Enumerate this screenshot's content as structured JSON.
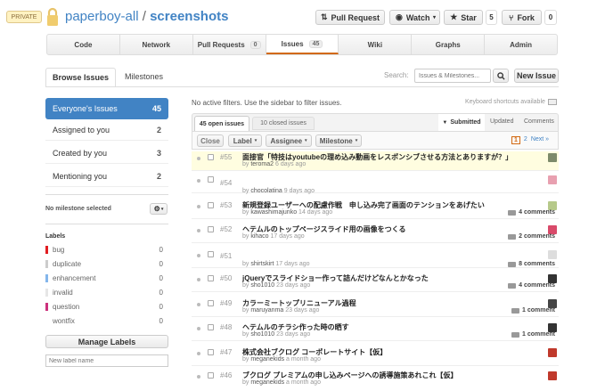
{
  "repo": {
    "badge": "PRIVATE",
    "owner": "paperboy-all",
    "sep": "/",
    "name": "screenshots"
  },
  "actions": {
    "pull_request": "Pull Request",
    "watch": "Watch",
    "star": "Star",
    "star_count": "5",
    "fork": "Fork",
    "fork_count": "0"
  },
  "nav": {
    "tabs": [
      {
        "label": "Code"
      },
      {
        "label": "Network"
      },
      {
        "label": "Pull Requests",
        "count": "0"
      },
      {
        "label": "Issues",
        "count": "45"
      },
      {
        "label": "Wiki"
      },
      {
        "label": "Graphs"
      },
      {
        "label": "Admin"
      }
    ]
  },
  "subtabs": {
    "browse": "Browse Issues",
    "milestones": "Milestones"
  },
  "search": {
    "label": "Search:",
    "placeholder": "Issues & Milestones...",
    "new_issue": "New Issue"
  },
  "filter_msg": "No active filters. Use the sidebar to filter issues.",
  "shortcuts": "Keyboard shortcuts available",
  "sidebar": {
    "items": [
      {
        "label": "Everyone's Issues",
        "count": "45"
      },
      {
        "label": "Assigned to you",
        "count": "2"
      },
      {
        "label": "Created by you",
        "count": "3"
      },
      {
        "label": "Mentioning you",
        "count": "2"
      }
    ],
    "milestone": "No milestone selected",
    "labels_heading": "Labels",
    "labels": [
      {
        "name": "bug",
        "count": "0",
        "color": "#e11d21"
      },
      {
        "name": "duplicate",
        "count": "0",
        "color": "#cccccc"
      },
      {
        "name": "enhancement",
        "count": "0",
        "color": "#84b6eb"
      },
      {
        "name": "invalid",
        "count": "0",
        "color": "#e6e6e6"
      },
      {
        "name": "question",
        "count": "0",
        "color": "#cc317c"
      },
      {
        "name": "wontfix",
        "count": "0",
        "color": "#ffffff"
      }
    ],
    "manage_labels": "Manage Labels",
    "new_label_placeholder": "New label name"
  },
  "list": {
    "open_tab": "45 open issues",
    "closed_tab": "10 closed issues",
    "sort": {
      "submitted": "Submitted",
      "updated": "Updated",
      "comments": "Comments"
    },
    "toolbar": {
      "close": "Close",
      "label": "Label",
      "assignee": "Assignee",
      "milestone": "Milestone"
    },
    "pagination": {
      "p1": "1",
      "p2": "2",
      "next": "Next »"
    }
  },
  "issues": [
    {
      "num": "#55",
      "title": "面接官「特技はyoutubeの理め込み動画をレスポンシブさせる方法とありますが？」",
      "user": "teroma2",
      "time": "6 days ago",
      "comments": "",
      "avatar": "#7d8a6a"
    },
    {
      "num": "#54",
      "title": "",
      "user": "chocolatina",
      "time": "9 days ago",
      "comments": "",
      "avatar": "#e8a0b0"
    },
    {
      "num": "#53",
      "title": "新規登録ユーザーへの配慮作戦　申し込み完了画面のテンションをあげたい",
      "user": "kawashimajunko",
      "time": "14 days ago",
      "comments": "4 comments",
      "avatar": "#b6c98a"
    },
    {
      "num": "#52",
      "title": "ヘテムルのトップページスライド用の画像をつくる",
      "user": "kihaco",
      "time": "17 days ago",
      "comments": "2 comments",
      "avatar": "#d94a6a"
    },
    {
      "num": "#51",
      "title": "",
      "user": "shirtskirt",
      "time": "17 days ago",
      "comments": "8 comments",
      "avatar": "#dddddd"
    },
    {
      "num": "#50",
      "title": "jQueryでスライドショー作って詰んだけどなんとかなった",
      "user": "sho1010",
      "time": "23 days ago",
      "comments": "4 comments",
      "avatar": "#333333"
    },
    {
      "num": "#49",
      "title": "カラーミートップリニューアル過程",
      "user": "maruyanma",
      "time": "23 days ago",
      "comments": "1 comment",
      "avatar": "#444444"
    },
    {
      "num": "#48",
      "title": "ヘテムルのチラシ作った時の晒す",
      "user": "sho1010",
      "time": "23 days ago",
      "comments": "1 comment",
      "avatar": "#333333"
    },
    {
      "num": "#47",
      "title": "株式会社ブクログ コーポレートサイト【仮】",
      "user": "meganekids",
      "time": "a month ago",
      "comments": "",
      "avatar": "#c0392b"
    },
    {
      "num": "#46",
      "title": "ブクログ プレミアムの申し込みページへの誘導施策あれこれ【仮】",
      "user": "meganekids",
      "time": "a month ago",
      "comments": "",
      "avatar": "#c0392b"
    }
  ]
}
